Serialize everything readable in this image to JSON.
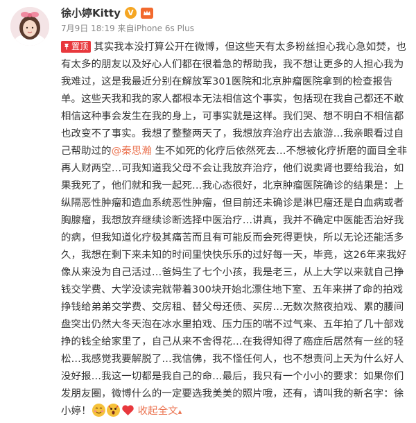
{
  "post": {
    "username": "徐小婷Kitty",
    "verified_badge": "V",
    "member_badge": "会员",
    "date": "7月9日 18:19",
    "source_prefix": "来自",
    "source_device": "iPhone 6s Plus",
    "pin_label": "置顶",
    "mention": "@秦思瀚",
    "text_before_mention": "其实我本没打算公开在微博，但这些天有太多粉丝担心我心急如焚，也有太多的朋友以及好心人们都在很着急的帮助我，我不想让更多的人担心我为我难过，这是我最近分别在解放军301医院和北京肿瘤医院拿到的检查报告单。这些天我和我的家人都根本无法相信这个事实，包括现在我自己都还不敢相信这种事会发生在我的身上，可事实就是这样。我们哭、想不明白不相信都也改变不了事实。我想了整整两天了，我想放弃治疗出去旅游…我亲眼看过自己帮助过的",
    "text_after_mention": "生不如死的化疗后依然死去…不想被化疗折磨的面目全非再人财两空…可我知道我父母不会让我放弃治疗，他们说卖肾也要给我治，如果我死了，他们就和我一起死…我心态很好，北京肿瘤医院确诊的结果是：上纵隔恶性肿瘤和造血系统恶性肿瘤，但目前还未确诊是淋巴瘤还是白血病或者胸腺瘤，我想放弃继续诊断选择中医治疗…讲真，我并不确定中医能否治好我的病，但我知道化疗极其痛苦而且有可能反而会死得更快，所以无论还能活多久，我想在剩下来未知的时间里快快乐乐的过好每一天，毕竟，这26年来我好像从来没为自己活过…爸妈生了七个小孩，我是老三，从上大学以来就自己挣钱交学费、大学没读完就带着300块开始北漂住地下室、五年来拼了命的拍戏挣钱给弟弟交学费、交房租、替父母还债、买房…无数次熬夜拍戏、累的腰间盘突出仍然大冬天泡在冰水里拍戏、压力压的喘不过气来、五年拍了几十部戏挣的钱全给家里了，自己从来不舍得花…在我得知得了癌症后居然有一丝的轻松…我感觉我要解脱了…我信佛，我不怪任何人，也不想责问上天为什么好人没好报…我这一切都是我自己的命…最后，我只有一个小小的要求：如果你们发朋友圈，微博什么的一定要选我美美的照片哦，还有，请叫我的新名字：徐小婷！",
    "collapse_label": "收起全文",
    "emojis": [
      "smile-emoji",
      "shock-emoji",
      "heart-emoji"
    ]
  },
  "colors": {
    "pin": "#e8383d",
    "link": "#eb7350",
    "verified": "#f5a623",
    "member": "#f26a2e",
    "meta": "#888888",
    "text": "#333333"
  }
}
